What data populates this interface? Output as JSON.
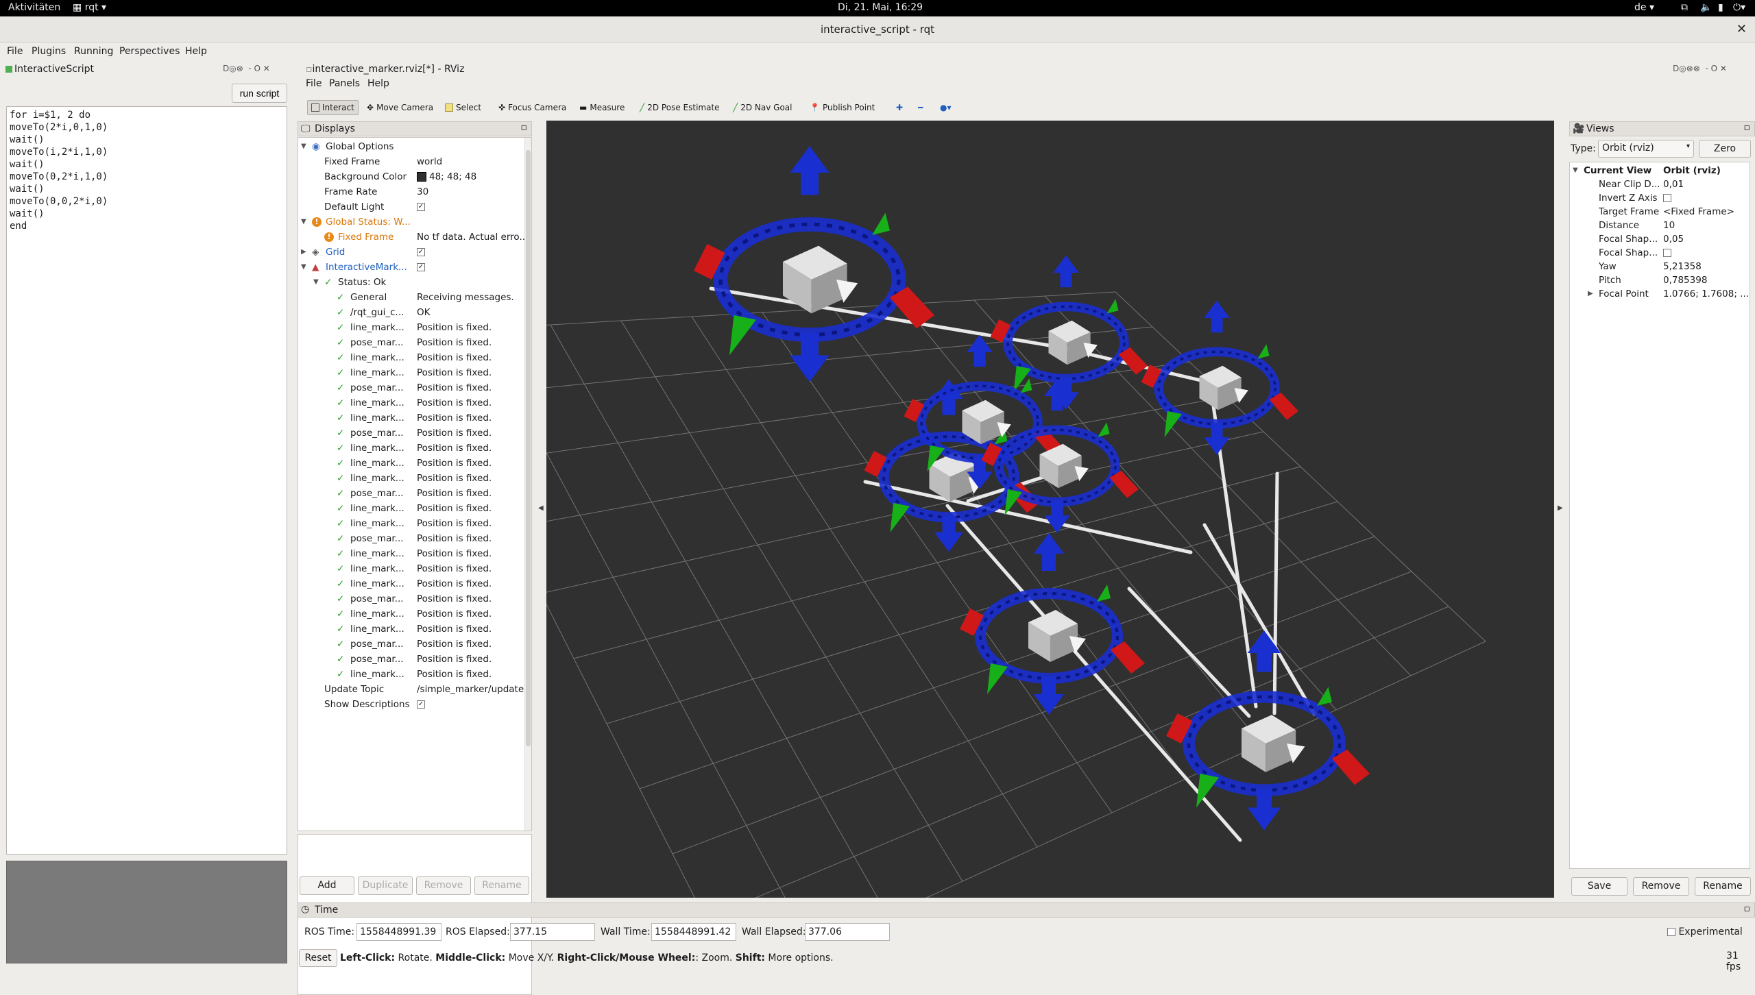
{
  "topbar": {
    "activities": "Aktivitäten",
    "app": "rqt ▾",
    "clock": "Di, 21. Mai, 16:29",
    "lang": "de ▾"
  },
  "window": {
    "title": "interactive_script - rqt"
  },
  "menu": {
    "file": "File",
    "plugins": "Plugins",
    "running": "Running",
    "perspectives": "Perspectives",
    "help": "Help"
  },
  "script_panel": {
    "title": "InteractiveScript",
    "run_label": "run script",
    "code": "for i=$1, 2 do\nmoveTo(2*i,0,1,0)\nwait()\nmoveTo(i,2*i,1,0)\nwait()\nmoveTo(0,2*i,1,0)\nwait()\nmoveTo(0,0,2*i,0)\nwait()\nend"
  },
  "rviz": {
    "title": "interactive_marker.rviz[*] - RViz",
    "menu": {
      "file": "File",
      "panels": "Panels",
      "help": "Help"
    },
    "tools": [
      "Interact",
      "Move Camera",
      "Select",
      "Focus Camera",
      "Measure",
      "2D Pose Estimate",
      "2D Nav Goal",
      "Publish Point"
    ]
  },
  "displays": {
    "title": "Displays",
    "rows": [
      {
        "k": "Global Options",
        "v": ""
      },
      {
        "k": "Fixed Frame",
        "v": "world"
      },
      {
        "k": "Background Color",
        "v": "48; 48; 48"
      },
      {
        "k": "Frame Rate",
        "v": "30"
      },
      {
        "k": "Default Light",
        "v": ""
      },
      {
        "k": "Global Status: W...",
        "v": ""
      },
      {
        "k": "Fixed Frame",
        "v": "No tf data.  Actual erro..."
      },
      {
        "k": "Grid",
        "v": ""
      },
      {
        "k": "InteractiveMark...",
        "v": ""
      },
      {
        "k": "Status: Ok",
        "v": ""
      },
      {
        "k": "General",
        "v": "Receiving messages."
      },
      {
        "k": "/rqt_gui_c...",
        "v": "OK"
      },
      {
        "k": "line_mark...",
        "v": "Position is fixed."
      },
      {
        "k": "pose_mar...",
        "v": "Position is fixed."
      },
      {
        "k": "line_mark...",
        "v": "Position is fixed."
      },
      {
        "k": "line_mark...",
        "v": "Position is fixed."
      },
      {
        "k": "pose_mar...",
        "v": "Position is fixed."
      },
      {
        "k": "line_mark...",
        "v": "Position is fixed."
      },
      {
        "k": "line_mark...",
        "v": "Position is fixed."
      },
      {
        "k": "pose_mar...",
        "v": "Position is fixed."
      },
      {
        "k": "line_mark...",
        "v": "Position is fixed."
      },
      {
        "k": "line_mark...",
        "v": "Position is fixed."
      },
      {
        "k": "line_mark...",
        "v": "Position is fixed."
      },
      {
        "k": "pose_mar...",
        "v": "Position is fixed."
      },
      {
        "k": "line_mark...",
        "v": "Position is fixed."
      },
      {
        "k": "line_mark...",
        "v": "Position is fixed."
      },
      {
        "k": "pose_mar...",
        "v": "Position is fixed."
      },
      {
        "k": "line_mark...",
        "v": "Position is fixed."
      },
      {
        "k": "line_mark...",
        "v": "Position is fixed."
      },
      {
        "k": "line_mark...",
        "v": "Position is fixed."
      },
      {
        "k": "pose_mar...",
        "v": "Position is fixed."
      },
      {
        "k": "line_mark...",
        "v": "Position is fixed."
      },
      {
        "k": "line_mark...",
        "v": "Position is fixed."
      },
      {
        "k": "pose_mar...",
        "v": "Position is fixed."
      },
      {
        "k": "pose_mar...",
        "v": "Position is fixed."
      },
      {
        "k": "line_mark...",
        "v": "Position is fixed."
      },
      {
        "k": "Update Topic",
        "v": "/simple_marker/update"
      },
      {
        "k": "Show Descriptions",
        "v": ""
      }
    ],
    "buttons": {
      "add": "Add",
      "duplicate": "Duplicate",
      "remove": "Remove",
      "rename": "Rename"
    }
  },
  "views": {
    "title": "Views",
    "type_label": "Type:",
    "type_value": "Orbit (rviz)",
    "zero": "Zero",
    "rows": [
      {
        "k": "Current View",
        "v": "Orbit (rviz)"
      },
      {
        "k": "Near Clip D...",
        "v": "0,01"
      },
      {
        "k": "Invert Z Axis",
        "v": ""
      },
      {
        "k": "Target Frame",
        "v": "<Fixed Frame>"
      },
      {
        "k": "Distance",
        "v": "10"
      },
      {
        "k": "Focal Shap...",
        "v": "0,05"
      },
      {
        "k": "Focal Shap...",
        "v": ""
      },
      {
        "k": "Yaw",
        "v": "5,21358"
      },
      {
        "k": "Pitch",
        "v": "0,785398"
      },
      {
        "k": "Focal Point",
        "v": "1.0766; 1.7608; ..."
      }
    ],
    "buttons": {
      "save": "Save",
      "remove": "Remove",
      "rename": "Rename"
    }
  },
  "time": {
    "title": "Time",
    "ros_time_label": "ROS Time:",
    "ros_time": "1558448991.39",
    "ros_elapsed_label": "ROS Elapsed:",
    "ros_elapsed": "377.15",
    "wall_time_label": "Wall Time:",
    "wall_time": "1558448991.42",
    "wall_elapsed_label": "Wall Elapsed:",
    "wall_elapsed": "377.06",
    "experimental": "Experimental",
    "reset": "Reset",
    "hint_1b": "Left-Click:",
    "hint_1": " Rotate. ",
    "hint_2b": "Middle-Click:",
    "hint_2": " Move X/Y. ",
    "hint_3b": "Right-Click/Mouse Wheel:",
    "hint_3": ": Zoom. ",
    "hint_4b": "Shift:",
    "hint_4": " More options.",
    "fps": "31 fps"
  },
  "colors": {
    "bg3d": "#303030",
    "ring": "#1a2fd0",
    "x_axis": "#d01818",
    "y_axis": "#18b018",
    "z_axis": "#1a2fd0"
  }
}
